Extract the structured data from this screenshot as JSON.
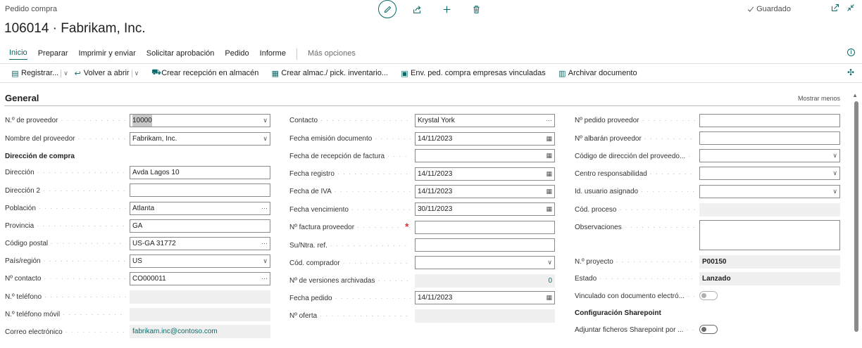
{
  "header": {
    "page_type": "Pedido compra",
    "title": "106014 · Fabrikam, Inc.",
    "saved": "Guardado"
  },
  "tabs": [
    {
      "label": "Inicio",
      "active": true
    },
    {
      "label": "Preparar"
    },
    {
      "label": "Imprimir y enviar"
    },
    {
      "label": "Solicitar aprobación"
    },
    {
      "label": "Pedido"
    },
    {
      "label": "Informe"
    }
  ],
  "more_options": "Más opciones",
  "actions": [
    {
      "label": "Registrar...",
      "icon": "post-icon",
      "dropdown": true
    },
    {
      "label": "Volver a abrir",
      "icon": "reopen-icon",
      "dropdown": true
    },
    {
      "label": "Crear recepción en almacén",
      "icon": "warehouse-receipt-icon"
    },
    {
      "label": "Crear almac./ pick. inventario...",
      "icon": "inventory-pick-icon"
    },
    {
      "label": "Env. ped. compra empresas vinculadas",
      "icon": "send-icon"
    },
    {
      "label": "Archivar documento",
      "icon": "archive-icon"
    }
  ],
  "section": {
    "title": "General",
    "show_less": "Mostrar menos"
  },
  "col1": {
    "vendor_no": {
      "label": "N.º de proveedor",
      "value": "10000"
    },
    "vendor_name": {
      "label": "Nombre del proveedor",
      "value": "Fabrikam, Inc."
    },
    "address_heading": "Dirección de compra",
    "address": {
      "label": "Dirección",
      "value": "Avda Lagos 10"
    },
    "address2": {
      "label": "Dirección 2",
      "value": ""
    },
    "city": {
      "label": "Población",
      "value": "Atlanta"
    },
    "county": {
      "label": "Provincia",
      "value": "GA"
    },
    "post_code": {
      "label": "Código postal",
      "value": "US-GA 31772"
    },
    "country": {
      "label": "País/región",
      "value": "US"
    },
    "contact_no": {
      "label": "Nº contacto",
      "value": "CO000011"
    },
    "phone": {
      "label": "N.º teléfono",
      "value": ""
    },
    "mobile": {
      "label": "N.º teléfono móvil",
      "value": ""
    },
    "email": {
      "label": "Correo electrónico",
      "value": "fabrikam.inc@contoso.com"
    }
  },
  "col2": {
    "contact": {
      "label": "Contacto",
      "value": "Krystal York"
    },
    "document_date": {
      "label": "Fecha emisión documento",
      "value": "14/11/2023"
    },
    "invoice_received_date": {
      "label": "Fecha de recepción de factura",
      "value": ""
    },
    "posting_date": {
      "label": "Fecha registro",
      "value": "14/11/2023"
    },
    "vat_date": {
      "label": "Fecha de IVA",
      "value": "14/11/2023"
    },
    "due_date": {
      "label": "Fecha vencimiento",
      "value": "30/11/2023"
    },
    "vendor_invoice_no": {
      "label": "Nº factura proveedor",
      "value": ""
    },
    "your_reference": {
      "label": "Su/Ntra. ref.",
      "value": ""
    },
    "purchaser_code": {
      "label": "Cód. comprador",
      "value": ""
    },
    "archived_versions": {
      "label": "Nº de versiones archivadas",
      "value": "0"
    },
    "order_date": {
      "label": "Fecha pedido",
      "value": "14/11/2023"
    },
    "quote_no": {
      "label": "Nº oferta",
      "value": ""
    }
  },
  "col3": {
    "vendor_order_no": {
      "label": "Nº pedido proveedor",
      "value": ""
    },
    "vendor_shipment_no": {
      "label": "Nº albarán proveedor",
      "value": ""
    },
    "order_address_code": {
      "label": "Código de dirección del proveedo...",
      "value": ""
    },
    "responsibility_center": {
      "label": "Centro responsabilidad",
      "value": ""
    },
    "assigned_user": {
      "label": "Id. usuario asignado",
      "value": ""
    },
    "job_queue_status": {
      "label": "Cód. proceso",
      "value": ""
    },
    "remarks": {
      "label": "Observaciones",
      "value": ""
    },
    "project_no": {
      "label": "N.º proyecto",
      "value": "P00150"
    },
    "status": {
      "label": "Estado",
      "value": "Lanzado"
    },
    "linked_doc": {
      "label": "Vinculado con documento electró...",
      "value": false
    },
    "sharepoint_heading": "Configuración Sharepoint",
    "sharepoint_attach": {
      "label": "Adjuntar ficheros Sharepoint por ...",
      "value": true
    }
  },
  "colors": {
    "accent": "#0b6a69",
    "required": "#d13438"
  }
}
